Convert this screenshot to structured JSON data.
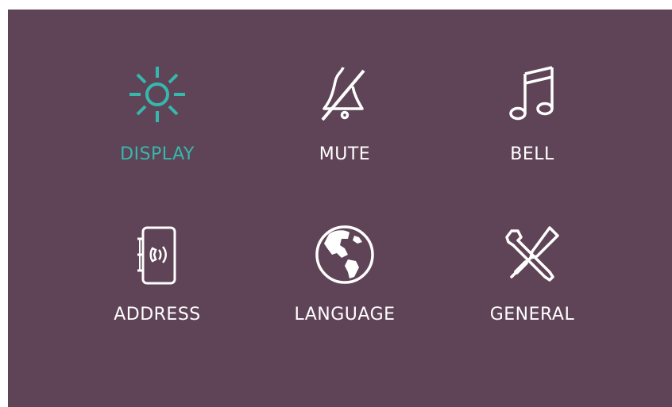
{
  "colors": {
    "background": "#5f4457",
    "text": "#ffffff",
    "selected": "#35b8ae"
  },
  "menu": {
    "selected": "DISPLAY",
    "items": [
      {
        "label": "DISPLAY",
        "icon": "sun-icon"
      },
      {
        "label": "MUTE",
        "icon": "bell-muted-icon"
      },
      {
        "label": "BELL",
        "icon": "music-note-icon"
      },
      {
        "label": "ADDRESS",
        "icon": "address-book-icon"
      },
      {
        "label": "LANGUAGE",
        "icon": "globe-icon"
      },
      {
        "label": "GENERAL",
        "icon": "tools-icon"
      }
    ]
  }
}
